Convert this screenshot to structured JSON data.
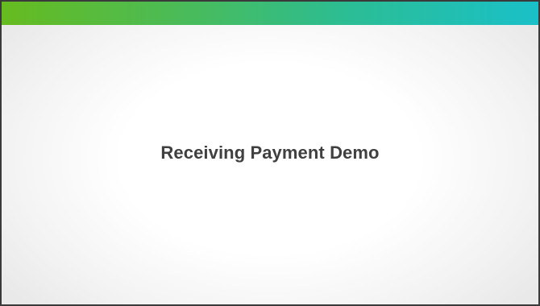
{
  "slide": {
    "title": "Receiving Payment Demo",
    "accent_gradient": [
      "#66bb1f",
      "#49bb5b",
      "#2bbd95",
      "#1ac0c8"
    ],
    "title_color": "#404040",
    "border_color": "#3a3a3a"
  }
}
